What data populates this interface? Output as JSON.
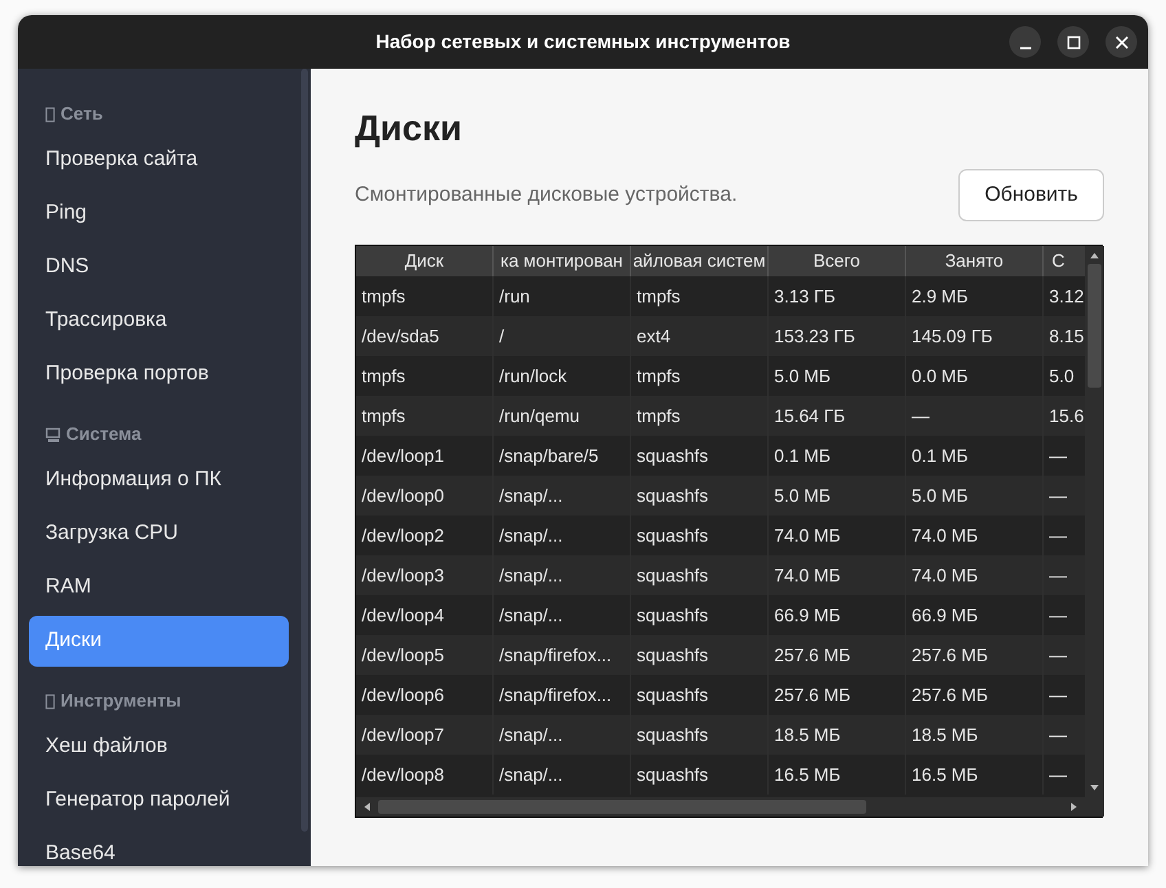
{
  "window": {
    "title": "Набор сетевых и системных инструментов"
  },
  "sidebar": {
    "sections": [
      {
        "title": "Сеть",
        "items": [
          {
            "label": "Проверка сайта",
            "selected": false
          },
          {
            "label": "Ping",
            "selected": false
          },
          {
            "label": "DNS",
            "selected": false
          },
          {
            "label": "Трассировка",
            "selected": false
          },
          {
            "label": "Проверка портов",
            "selected": false
          }
        ]
      },
      {
        "title": "Система",
        "items": [
          {
            "label": "Информация о ПК",
            "selected": false
          },
          {
            "label": "Загрузка CPU",
            "selected": false
          },
          {
            "label": "RAM",
            "selected": false
          },
          {
            "label": "Диски",
            "selected": true
          }
        ]
      },
      {
        "title": "Инструменты",
        "items": [
          {
            "label": "Хеш файлов",
            "selected": false
          },
          {
            "label": "Генератор паролей",
            "selected": false
          },
          {
            "label": "Base64",
            "selected": false
          }
        ]
      }
    ]
  },
  "page": {
    "title": "Диски",
    "description": "Смонтированные дисковые устройства.",
    "refresh_button": "Обновить"
  },
  "table": {
    "columns": [
      "Диск",
      "ка монтирован",
      "айловая систем",
      "Всего",
      "Занято",
      "С"
    ],
    "rows": [
      [
        "tmpfs",
        "/run",
        "tmpfs",
        "3.13 ГБ",
        "2.9 МБ",
        "3.12"
      ],
      [
        "/dev/sda5",
        "/",
        "ext4",
        "153.23 ГБ",
        "145.09 ГБ",
        "8.15"
      ],
      [
        "tmpfs",
        "/run/lock",
        "tmpfs",
        "5.0 МБ",
        "0.0 МБ",
        "5.0"
      ],
      [
        "tmpfs",
        "/run/qemu",
        "tmpfs",
        "15.64 ГБ",
        "—",
        "15.6"
      ],
      [
        "/dev/loop1",
        "/snap/bare/5",
        "squashfs",
        "0.1 МБ",
        "0.1 МБ",
        "—"
      ],
      [
        "/dev/loop0",
        "/snap/...",
        "squashfs",
        "5.0 МБ",
        "5.0 МБ",
        "—"
      ],
      [
        "/dev/loop2",
        "/snap/...",
        "squashfs",
        "74.0 МБ",
        "74.0 МБ",
        "—"
      ],
      [
        "/dev/loop3",
        "/snap/...",
        "squashfs",
        "74.0 МБ",
        "74.0 МБ",
        "—"
      ],
      [
        "/dev/loop4",
        "/snap/...",
        "squashfs",
        "66.9 МБ",
        "66.9 МБ",
        "—"
      ],
      [
        "/dev/loop5",
        "/snap/firefox...",
        "squashfs",
        "257.6 МБ",
        "257.6 МБ",
        "—"
      ],
      [
        "/dev/loop6",
        "/snap/firefox...",
        "squashfs",
        "257.6 МБ",
        "257.6 МБ",
        "—"
      ],
      [
        "/dev/loop7",
        "/snap/...",
        "squashfs",
        "18.5 МБ",
        "18.5 МБ",
        "—"
      ],
      [
        "/dev/loop8",
        "/snap/...",
        "squashfs",
        "16.5 МБ",
        "16.5 МБ",
        "—"
      ]
    ]
  }
}
